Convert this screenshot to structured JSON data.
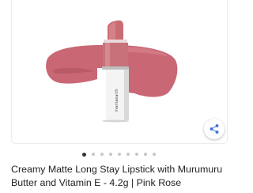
{
  "product": {
    "title": "Creamy Matte Long Stay Lipstick with Murumuru Butter and Vitamin E  - 4.2g | Pink Rose",
    "brand_label": "mamaearth",
    "colors": {
      "lipstick": "#c96c74",
      "swatch": "#c65f6d",
      "case": "#f4f4f4"
    }
  },
  "gallery": {
    "total_images": 9,
    "active_index": 0
  },
  "actions": {
    "share_icon": "share-icon"
  }
}
